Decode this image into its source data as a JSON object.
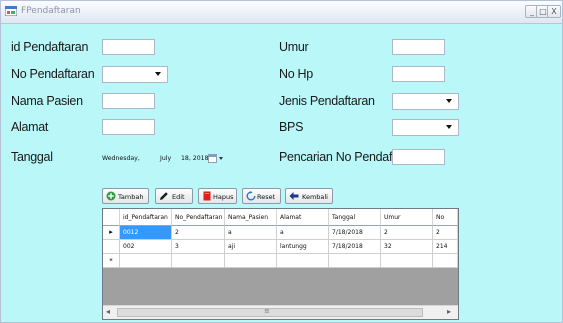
{
  "window": {
    "title": "FPendaftaran",
    "minimize": "_",
    "maximize": "□",
    "close": "X"
  },
  "form": {
    "id_pendaftaran_label": "id Pendaftaran",
    "no_pendaftaran_label": "No Pendaftaran",
    "nama_pasien_label": "Nama Pasien",
    "alamat_label": "Alamat",
    "tanggal_label": "Tanggal",
    "umur_label": "Umur",
    "no_hp_label": "No Hp",
    "jenis_pendaftaran_label": "Jenis Pendaftaran",
    "bps_label": "BPS",
    "pencarian_label": "Pencarian No Pendaftaran",
    "date_day": "Wednesday,",
    "date_month": "July",
    "date_rest": "18, 2018"
  },
  "buttons": {
    "tambah": "Tambah",
    "edit": "Edit",
    "hapus": "Hapus",
    "reset": "Reset",
    "kembali": "Kembali"
  },
  "table": {
    "columns": [
      "id_Pendaftaran",
      "No_Pendaftaran",
      "Nama_Pasien",
      "Alamat",
      "Tanggal",
      "Umur",
      "No"
    ],
    "rows": [
      [
        "0012",
        "2",
        "a",
        "a",
        "7/18/2018",
        "2",
        "2"
      ],
      [
        "002",
        "3",
        "aji",
        "lantungg",
        "7/18/2018",
        "32",
        "214"
      ]
    ],
    "current_row_marker": "▸",
    "new_row_marker": "*",
    "scroll_left": "◂",
    "scroll_right": "▸",
    "scroll_grip": "≡"
  },
  "colors": {
    "form_bg": "#b9f7f9",
    "grid_bg": "#a0a0a0",
    "selection": "#3399ff"
  },
  "icons": [
    "app-form-icon",
    "add-circle-icon",
    "pencil-icon",
    "delete-icon",
    "refresh-icon",
    "back-arrow-icon",
    "calendar-icon"
  ]
}
